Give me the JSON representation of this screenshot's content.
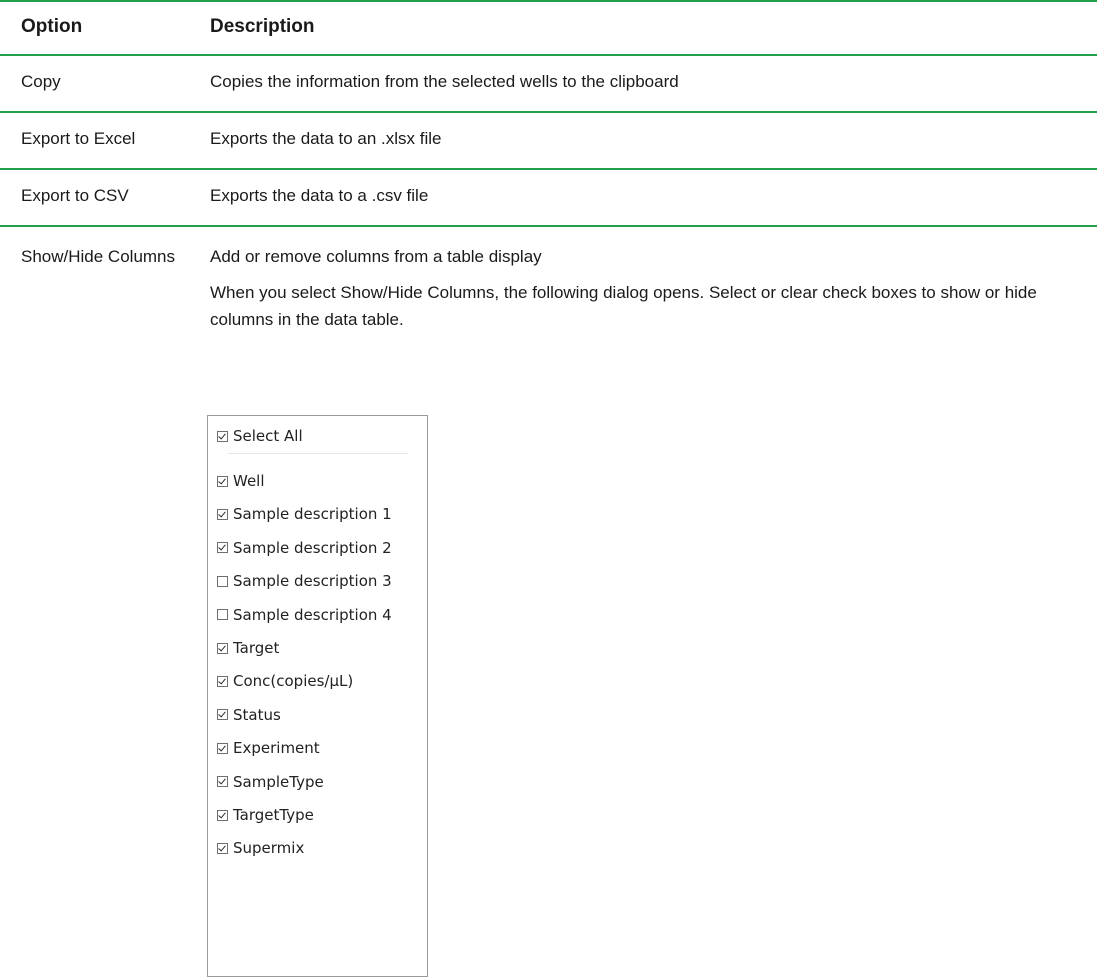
{
  "table": {
    "header": {
      "option": "Option",
      "description": "Description"
    },
    "rows": [
      {
        "option": "Copy",
        "description": "Copies the information from the selected wells to the clipboard"
      },
      {
        "option": "Export to Excel",
        "description": "Exports the data to an .xlsx file"
      },
      {
        "option": "Export to CSV",
        "description": "Exports the data to a .csv file"
      },
      {
        "option": "Show/Hide Columns",
        "description_line1": "Add or remove columns from a table display",
        "description_line2": "When you select Show/Hide Columns, the following dialog opens. Select or clear check boxes to show or hide columns in the data table."
      }
    ]
  },
  "dialog": {
    "select_all": {
      "label": "Select All",
      "checked": true
    },
    "columns": [
      {
        "label": "Well",
        "checked": true
      },
      {
        "label": "Sample description 1",
        "checked": true
      },
      {
        "label": "Sample description 2",
        "checked": true
      },
      {
        "label": "Sample description 3",
        "checked": false
      },
      {
        "label": "Sample description 4",
        "checked": false
      },
      {
        "label": "Target",
        "checked": true
      },
      {
        "label": "Conc(copies/µL)",
        "checked": true
      },
      {
        "label": "Status",
        "checked": true
      },
      {
        "label": "Experiment",
        "checked": true
      },
      {
        "label": "SampleType",
        "checked": true
      },
      {
        "label": "TargetType",
        "checked": true
      },
      {
        "label": "Supermix",
        "checked": true
      }
    ]
  },
  "colors": {
    "rule": "#21a04a",
    "text": "#1a1a1a",
    "dialog_border": "#9a9a9a"
  }
}
